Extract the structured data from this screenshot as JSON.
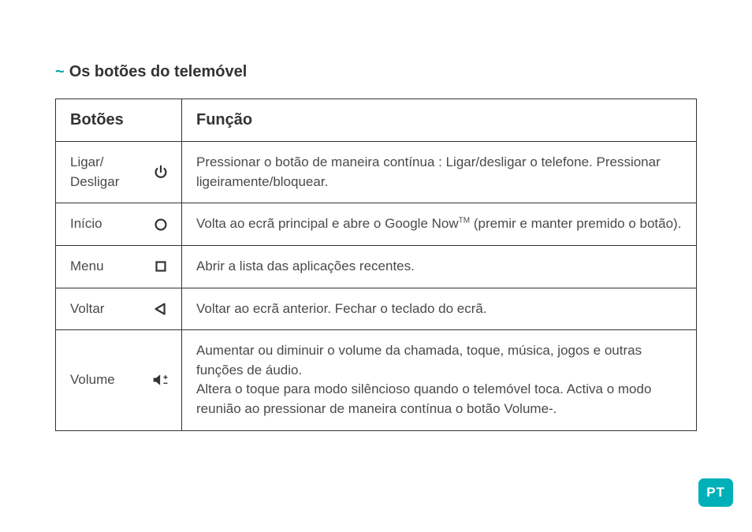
{
  "section": {
    "tilde": "~",
    "title": "Os botões do telemóvel"
  },
  "table": {
    "headers": {
      "buttons": "Botões",
      "function": "Função"
    },
    "rows": [
      {
        "label": "Ligar/\nDesligar",
        "icon": "power-icon",
        "desc": "Pressionar o botão de maneira contínua : Ligar/desligar o telefone. Pressionar ligeiramente/bloquear."
      },
      {
        "label": "Início",
        "icon": "home-circle-icon",
        "desc_prefix": "Volta ao ecrã principal e abre o Google Now",
        "desc_tm": "TM",
        "desc_suffix": " (premir e manter premido o botão)."
      },
      {
        "label": "Menu",
        "icon": "recent-square-icon",
        "desc": "Abrir a lista das aplicações recentes."
      },
      {
        "label": "Voltar",
        "icon": "back-triangle-icon",
        "desc": "Voltar ao ecrã anterior. Fechar o teclado do ecrã."
      },
      {
        "label": "Volume",
        "icon": "volume-icon",
        "desc": "Aumentar ou diminuir o volume da chamada, toque, música, jogos e outras funções de áudio.\nAltera o toque para modo silêncioso quando o telemóvel toca. Activa o modo reunião ao pressionar de maneira contínua o botão Volume-."
      }
    ]
  },
  "lang_tab": "PT"
}
